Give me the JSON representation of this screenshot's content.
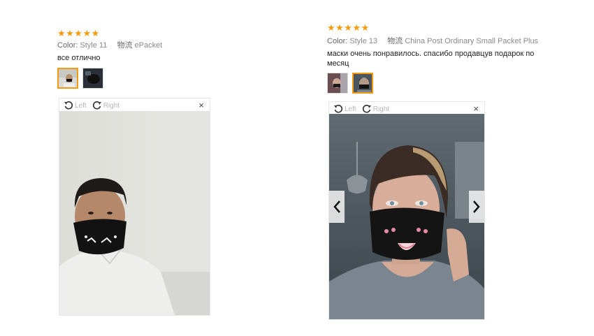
{
  "reviews": [
    {
      "stars": "★★★★★",
      "color_label": "Color:",
      "color_value": "Style 11",
      "shipping_label": "物流",
      "shipping_value": "ePacket",
      "text": "все отлично",
      "viewer": {
        "rotate_left": "Left",
        "rotate_right": "Right",
        "close": "×"
      }
    },
    {
      "stars": "★★★★★",
      "color_label": "Color:",
      "color_value": "Style 13",
      "shipping_label": "物流",
      "shipping_value": "China Post Ordinary Small Packet Plus",
      "text_line1": "маски очень понравилось. спасибо продавцув подарок по",
      "text_line2": "месяц",
      "viewer": {
        "rotate_left": "Left",
        "rotate_right": "Right",
        "close": "×",
        "prev": "‹",
        "next": "›"
      }
    }
  ],
  "colors": {
    "star": "#f39c12",
    "active_border": "#f39c12"
  }
}
